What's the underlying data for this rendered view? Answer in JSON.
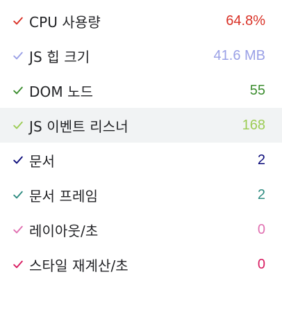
{
  "metrics": [
    {
      "label": "CPU 사용량",
      "value": "64.8%",
      "color": "#d93025",
      "checked": true,
      "icon": "checkmark-icon"
    },
    {
      "label": "JS 힙 크기",
      "value": "41.6 MB",
      "color": "#9aa0e6",
      "checked": true,
      "icon": "checkmark-icon"
    },
    {
      "label": "DOM 노드",
      "value": "55",
      "color": "#3c8d2f",
      "checked": true,
      "icon": "checkmark-icon"
    },
    {
      "label": "JS 이벤트 리스너",
      "value": "168",
      "color": "#9ccc54",
      "checked": true,
      "icon": "checkmark-icon"
    },
    {
      "label": "문서",
      "value": "2",
      "color": "#0a0a7a",
      "checked": true,
      "icon": "checkmark-icon"
    },
    {
      "label": "문서 프레임",
      "value": "2",
      "color": "#2e8b80",
      "checked": true,
      "icon": "checkmark-icon"
    },
    {
      "label": "레이아웃/초",
      "value": "0",
      "color": "#e06fb0",
      "checked": true,
      "icon": "checkmark-icon"
    },
    {
      "label": "스타일 재계산/초",
      "value": "0",
      "color": "#d81b60",
      "checked": true,
      "icon": "checkmark-icon"
    }
  ]
}
